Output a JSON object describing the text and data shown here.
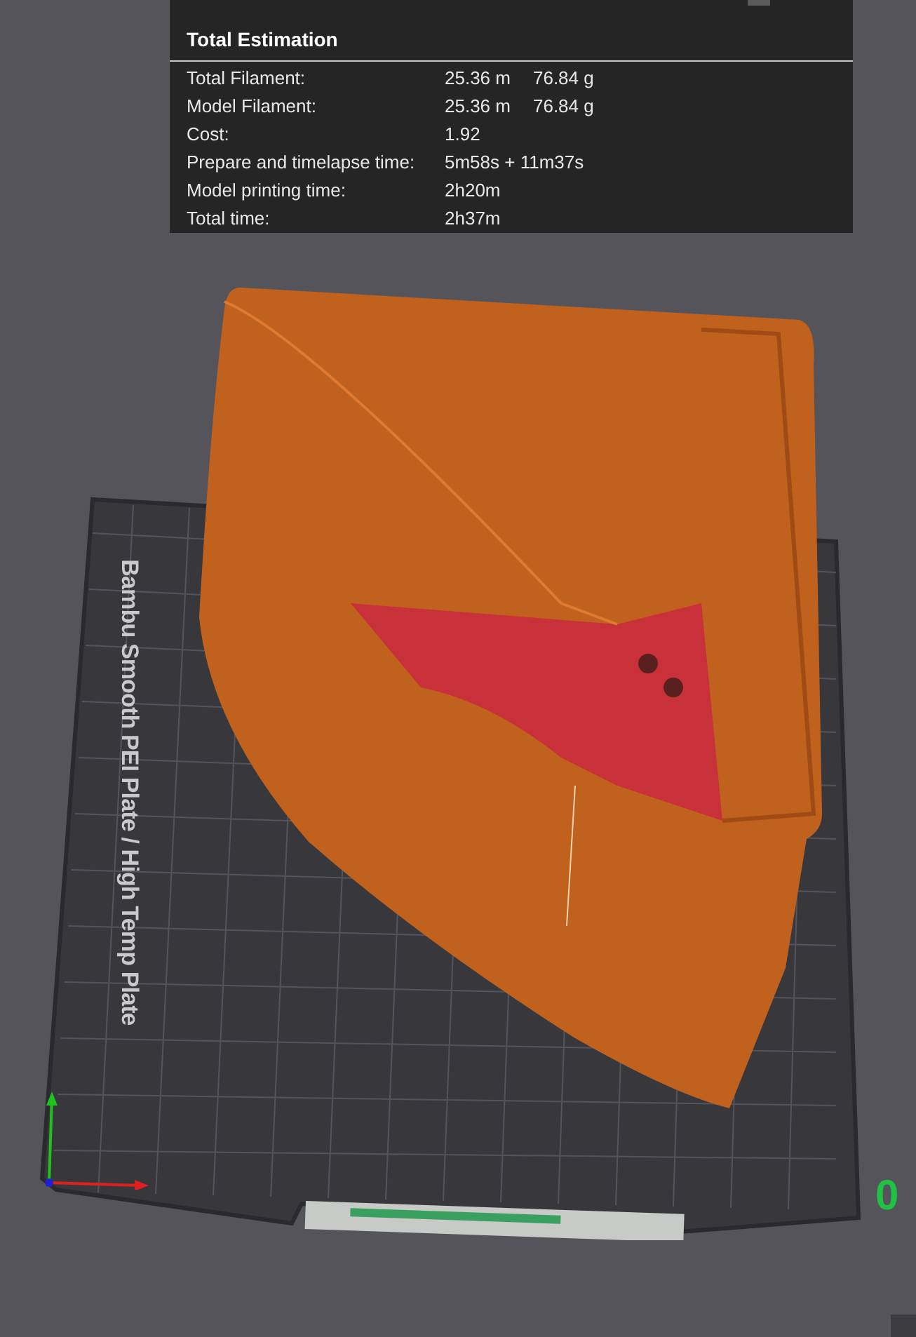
{
  "estimation": {
    "title": "Total Estimation",
    "rows": [
      {
        "label": "Total Filament:",
        "values": [
          "25.36 m",
          "76.84 g"
        ]
      },
      {
        "label": "Model Filament:",
        "values": [
          "25.36 m",
          "76.84 g"
        ]
      },
      {
        "label": "Cost:",
        "values": [
          "1.92"
        ]
      },
      {
        "label": "Prepare and timelapse time:",
        "values": [
          "5m58s + 11m37s"
        ]
      },
      {
        "label": "Model printing time:",
        "values": [
          "2h20m"
        ]
      },
      {
        "label": "Total time:",
        "values": [
          "2h37m"
        ]
      }
    ]
  },
  "plate": {
    "label": "Bambu Smooth PEI Plate / High Temp Plate"
  },
  "layer_number": "0"
}
